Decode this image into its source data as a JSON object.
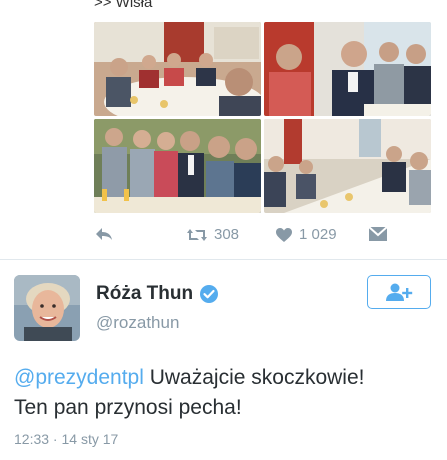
{
  "header": {
    "partial_text": ">> Wisła"
  },
  "media": {
    "photos": [
      {
        "alt": "photo-1"
      },
      {
        "alt": "photo-2"
      },
      {
        "alt": "photo-3"
      },
      {
        "alt": "photo-4"
      }
    ]
  },
  "actions": {
    "retweet_count": "308",
    "like_count": "1 029"
  },
  "tweet": {
    "display_name": "Róża Thun",
    "handle": "@rozathun",
    "mention": "@prezydentpl",
    "text_line1": " Uważajcie skoczkowie!",
    "text_line2": "Ten pan przynosi pecha!",
    "timestamp": "12:33 · 14 sty 17"
  },
  "colors": {
    "accent": "#55acee",
    "muted": "#8899a6",
    "text": "#292f33"
  }
}
